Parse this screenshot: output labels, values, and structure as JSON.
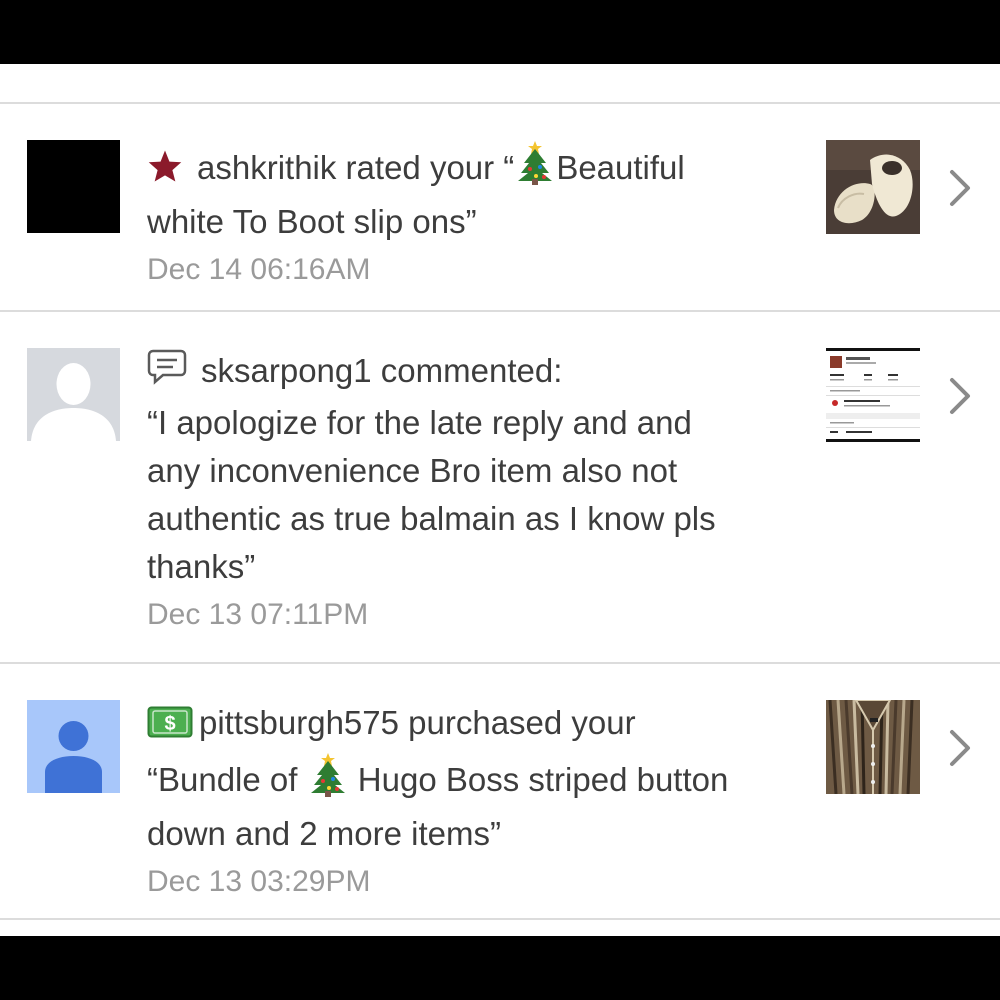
{
  "notifications": [
    {
      "icon": "star-icon",
      "username": "ashkrithik",
      "prefix": " rated your “",
      "text": "Beautiful\nwhite To Boot slip ons”",
      "time": "Dec 14 06:16AM",
      "thumb": "white-slip-on-shoes"
    },
    {
      "icon": "comment-icon",
      "username": "sksarpong1",
      "prefix": " commented:",
      "text": "“I apologize for the late reply and and\nany inconvenience Bro item also not\nauthentic as true balmain as I know pls\nthanks”",
      "time": "Dec 13 07:11PM",
      "thumb": "profile-screenshot"
    },
    {
      "icon": "dollar-icon",
      "username": "pittsburgh575",
      "prefix": " purchased your",
      "text_a": "“Bundle of ",
      "text_b": " Hugo Boss striped button\ndown and 2 more items”",
      "time": "Dec 13 03:29PM",
      "thumb": "striped-shirt"
    }
  ],
  "colors": {
    "star": "#8b1a2b",
    "dollar": "#4caf50",
    "timestamp": "#9a9a9a",
    "text": "#3d3d3d"
  }
}
